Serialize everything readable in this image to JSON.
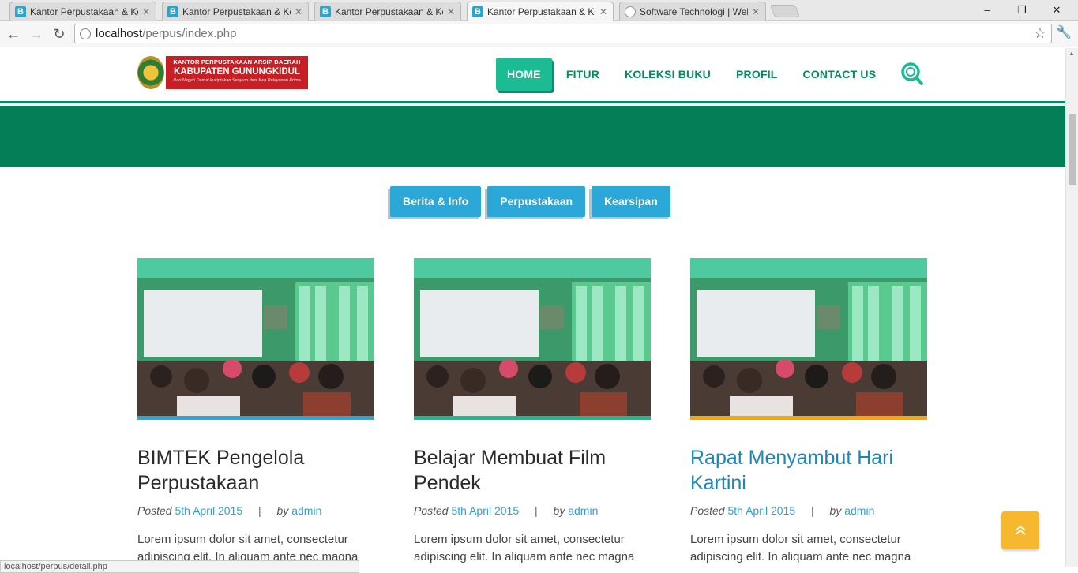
{
  "browser": {
    "tabs": [
      {
        "title": "Kantor Perpustakaan & Ke",
        "favicon": "b-icon"
      },
      {
        "title": "Kantor Perpustakaan & Ke",
        "favicon": "b-icon"
      },
      {
        "title": "Kantor Perpustakaan & Ke",
        "favicon": "b-icon"
      },
      {
        "title": "Kantor Perpustakaan & Ke",
        "favicon": "b-icon",
        "active": true
      },
      {
        "title": "Software Technologi | Web",
        "favicon": "globe-icon"
      }
    ],
    "url_host": "localhost",
    "url_path": "/perpus/index.php",
    "status_url": "localhost/perpus/detail.php",
    "window_controls": {
      "minimize": "–",
      "restore": "❐",
      "close": "✕"
    }
  },
  "logo": {
    "line1": "KANTOR PERPUSTAKAAN ARSIP DAERAH",
    "line2": "KABUPATEN GUNUNGKIDUL",
    "line3": "Dari Negeri Damai kuciptakan Senyum dan Jiwa Pelayanan Prima"
  },
  "nav": {
    "items": [
      "HOME",
      "FITUR",
      "KOLEKSI BUKU",
      "PROFIL",
      "CONTACT US"
    ],
    "active": "HOME"
  },
  "filters": [
    "Berita & Info",
    "Perpustakaan",
    "Kearsipan"
  ],
  "posts": [
    {
      "title_line1": "BIMTEK Pengelola",
      "title_line2": "Perpustakaan",
      "posted_label": "Posted",
      "date": "5th April 2015",
      "by_label": "by",
      "author": "admin",
      "separator": "|",
      "excerpt_line1": "Lorem ipsum dolor sit amet, consectetur",
      "excerpt_line2": "adipiscing elit. In aliquam ante nec magna",
      "accent": "#2ba8d8"
    },
    {
      "title_line1": "Belajar Membuat Film",
      "title_line2": "Pendek",
      "posted_label": "Posted",
      "date": "5th April 2015",
      "by_label": "by",
      "author": "admin",
      "separator": "|",
      "excerpt_line1": "Lorem ipsum dolor sit amet, consectetur",
      "excerpt_line2": "adipiscing elit. In aliquam ante nec magna",
      "accent": "#1bbc94"
    },
    {
      "title_line1": "Rapat Menyambut Hari",
      "title_line2": "Kartini",
      "posted_label": "Posted",
      "date": "5th April 2015",
      "by_label": "by",
      "author": "admin",
      "separator": "|",
      "excerpt_line1": "Lorem ipsum dolor sit amet, consectetur",
      "excerpt_line2": "adipiscing elit. In aliquam ante nec magna",
      "accent": "#f5a800"
    }
  ],
  "colors": {
    "primary_green": "#068a5e",
    "nav_active": "#1bbc94",
    "filter_blue": "#2ba8d8",
    "totop_yellow": "#f5b82e"
  }
}
